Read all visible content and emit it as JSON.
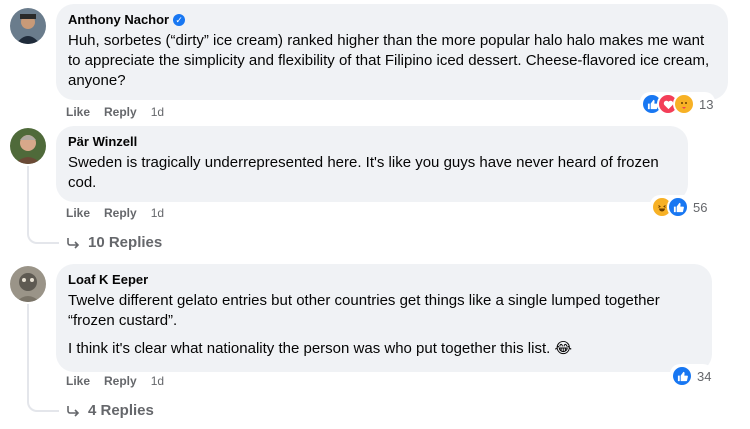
{
  "comments": [
    {
      "author": "Anthony Nachor",
      "verified": true,
      "paragraphs": [
        "Huh, sorbetes (“dirty” ice cream) ranked higher than the more popular halo halo makes me want to appreciate the simplicity and flexibility of that Filipino iced dessert. Cheese-flavored ice cream, anyone?"
      ],
      "like_label": "Like",
      "reply_label": "Reply",
      "time": "1d",
      "reaction_count": "13",
      "reactions": [
        "like",
        "love",
        "care"
      ]
    },
    {
      "author": "Pär Winzell",
      "verified": false,
      "paragraphs": [
        "Sweden is tragically underrepresented here. It's like you guys have never heard of frozen cod."
      ],
      "like_label": "Like",
      "reply_label": "Reply",
      "time": "1d",
      "reaction_count": "56",
      "reactions": [
        "haha",
        "like"
      ],
      "replies_label": "10 Replies"
    },
    {
      "author": "Loaf K Eeper",
      "verified": false,
      "paragraphs": [
        "Twelve different gelato entries but other countries get things like a single lumped together “frozen custard”.",
        "I think it's clear what nationality the person was who put together this list. 😂"
      ],
      "like_label": "Like",
      "reply_label": "Reply",
      "time": "1d",
      "reaction_count": "34",
      "reactions": [
        "like"
      ],
      "replies_label": "4 Replies"
    }
  ],
  "colors": {
    "bubble": "#f0f2f5",
    "meta": "#65676b",
    "like": "#1877f2",
    "love": "#f33e58",
    "haha": "#f7b125"
  },
  "icons": {
    "like": "thumbs-up-icon",
    "love": "heart-icon",
    "care": "care-icon",
    "haha": "haha-icon",
    "reply_arrow": "reply-arrow-icon"
  }
}
